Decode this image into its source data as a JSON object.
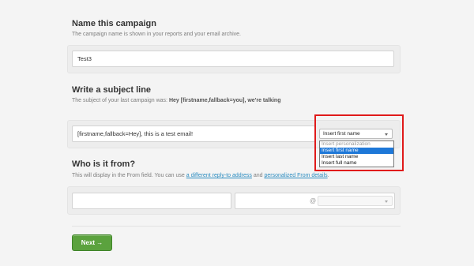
{
  "campaign": {
    "title": "Name this campaign",
    "desc": "The campaign name is shown in your reports and your email archive.",
    "value": "Test3"
  },
  "subject": {
    "title": "Write a subject line",
    "desc_prefix": "The subject of your last campaign was:",
    "last_subject": "Hey [firstname,fallback=you], we're talking",
    "value": "[firstname,fallback=Hey], this is a test email!",
    "personalize_select": "Insert first name",
    "options": [
      "Insert personalization",
      "Insert first name",
      "Insert last name",
      "Insert full name"
    ]
  },
  "from": {
    "title": "Who is it from?",
    "desc_a": "This will display in the From field. You can use",
    "link1": "a different reply-to address",
    "desc_b": "and",
    "link2": "personalized From details",
    "desc_c": ".",
    "at_symbol": "@"
  },
  "next_label": "Next →"
}
